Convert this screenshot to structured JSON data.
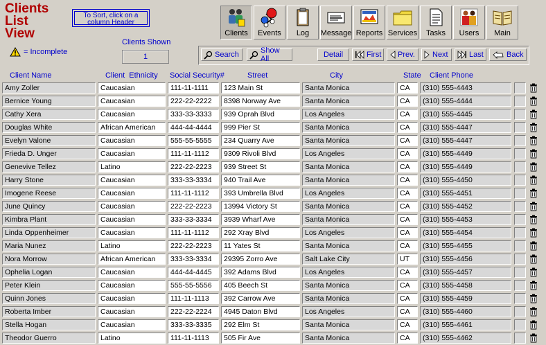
{
  "title": [
    "Clients",
    "List",
    "View"
  ],
  "sort_hint": [
    "To Sort, click on a",
    "column Header"
  ],
  "incomplete_label": "= Incomplete",
  "clients_shown_label": "Clients Shown",
  "clients_shown_value": "1",
  "toolbar": [
    {
      "label": "Clients",
      "icon": "clients-icon",
      "active": true
    },
    {
      "label": "Events",
      "icon": "events-icon"
    },
    {
      "label": "Log",
      "icon": "log-icon"
    },
    {
      "label": "Message",
      "icon": "message-icon"
    },
    {
      "label": "Reports",
      "icon": "reports-icon"
    },
    {
      "label": "Services",
      "icon": "services-icon"
    },
    {
      "label": "Tasks",
      "icon": "tasks-icon"
    },
    {
      "label": "Users",
      "icon": "users-icon"
    },
    {
      "label": "Main",
      "icon": "main-icon"
    }
  ],
  "nav": {
    "search": "Search",
    "show_all": "Show All",
    "detail": "Detail",
    "first": "First",
    "prev": "Prev.",
    "next": "Next",
    "last": "Last",
    "back": "Back"
  },
  "columns": [
    "Client Name",
    "Client  Ethnicity",
    "Social Security#",
    "Street",
    "City",
    "State",
    "Client Phone"
  ],
  "rows": [
    [
      "Amy Zoller",
      "Caucasian",
      "111-11-1111",
      "123 Main St",
      "Santa Monica",
      "CA",
      "(310) 555-4443"
    ],
    [
      "Bernice Young",
      "Caucasian",
      "222-22-2222",
      "8398 Norway Ave",
      "Santa Monica",
      "CA",
      "(310) 555-4444"
    ],
    [
      "Cathy Xera",
      "Caucasian",
      "333-33-3333",
      "939 Oprah Blvd",
      "Los Angeles",
      "CA",
      "(310) 555-4445"
    ],
    [
      "Douglas White",
      "African American",
      "444-44-4444",
      "999 Pier St",
      "Santa Monica",
      "CA",
      "(310) 555-4447"
    ],
    [
      "Evelyn Valone",
      "Caucasian",
      "555-55-5555",
      "234 Quarry Ave",
      "Santa Monica",
      "CA",
      "(310) 555-4447"
    ],
    [
      "Frieda D. Unger",
      "Caucasian",
      "111-11-1112",
      "9309 Rivoli Blvd",
      "Los Angeles",
      "CA",
      "(310) 555-4449"
    ],
    [
      "Genevive Tellez",
      "Latino",
      "222-22-2223",
      "939 Street St",
      "Santa Monica",
      "CA",
      "(310) 555-4449"
    ],
    [
      "Harry Stone",
      "Caucasian",
      "333-33-3334",
      "940 Trail Ave",
      "Santa Monica",
      "CA",
      "(310) 555-4450"
    ],
    [
      "Imogene Reese",
      "Caucasian",
      "111-11-1112",
      "393 Umbrella Blvd",
      "Los Angeles",
      "CA",
      "(310) 555-4451"
    ],
    [
      "June Quincy",
      "Caucasian",
      "222-22-2223",
      "13994 Victory St",
      "Santa Monica",
      "CA",
      "(310) 555-4452"
    ],
    [
      "Kimbra Plant",
      "Caucasian",
      "333-33-3334",
      "3939 Wharf Ave",
      "Santa Monica",
      "CA",
      "(310) 555-4453"
    ],
    [
      "Linda Oppenheimer",
      "Caucasian",
      "111-11-1112",
      "292 Xray Blvd",
      "Los Angeles",
      "CA",
      "(310) 555-4454"
    ],
    [
      "Maria Nunez",
      "Latino",
      "222-22-2223",
      "11 Yates St",
      "Santa Monica",
      "CA",
      "(310) 555-4455"
    ],
    [
      "Nora Morrow",
      "African American",
      "333-33-3334",
      "29395 Zorro Ave",
      "Salt Lake City",
      "UT",
      "(310) 555-4456"
    ],
    [
      "Ophelia Logan",
      "Caucasian",
      "444-44-4445",
      "392 Adams Blvd",
      "Los Angeles",
      "CA",
      "(310) 555-4457"
    ],
    [
      "Peter Klein",
      "Caucasian",
      "555-55-5556",
      "405 Beech St",
      "Santa Monica",
      "CA",
      "(310) 555-4458"
    ],
    [
      "Quinn Jones",
      "Caucasian",
      "111-11-1113",
      "392 Carrow Ave",
      "Santa Monica",
      "CA",
      "(310) 555-4459"
    ],
    [
      "Roberta Imber",
      "Caucasian",
      "222-22-2224",
      "4945 Daton Blvd",
      "Los Angeles",
      "CA",
      "(310) 555-4460"
    ],
    [
      "Stella Hogan",
      "Caucasian",
      "333-33-3335",
      "292 Elm St",
      "Santa Monica",
      "CA",
      "(310) 555-4461"
    ],
    [
      "Theodor Guerro",
      "Latino",
      "111-11-1113",
      "505 Fir Ave",
      "Santa Monica",
      "CA",
      "(310) 555-4462"
    ]
  ],
  "colors": {
    "title": "#b00000",
    "link": "#0000cc",
    "bg": "#d4d0c8"
  }
}
